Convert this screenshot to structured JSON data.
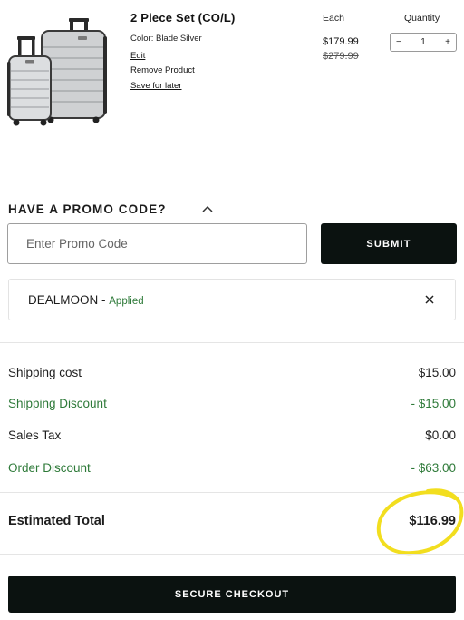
{
  "product": {
    "name": "2 Piece Set (CO/L)",
    "color": "Color: Blade Silver",
    "edit_label": "Edit",
    "remove_label": "Remove Product",
    "save_label": "Save for later",
    "each_header": "Each",
    "price": "$179.99",
    "original_price": "$279.99",
    "quantity_header": "Quantity",
    "quantity": "1",
    "decrement": "−",
    "increment": "+"
  },
  "promo": {
    "heading": "HAVE A PROMO CODE?",
    "placeholder": "Enter Promo Code",
    "submit_label": "SUBMIT",
    "applied_code": "DEALMOON",
    "applied_separator": " - ",
    "applied_status": "Applied"
  },
  "summary": {
    "rows": [
      {
        "label": "Shipping cost",
        "value": "$15.00"
      },
      {
        "label": "Shipping Discount",
        "value": "- $15.00"
      },
      {
        "label": "Sales Tax",
        "value": "$0.00"
      },
      {
        "label": "Order Discount",
        "value": "- $63.00"
      }
    ],
    "total_label": "Estimated Total",
    "total_value": "$116.99"
  },
  "checkout": {
    "label": "SECURE CHECKOUT"
  },
  "colors": {
    "dark_button": "#0b1210",
    "discount_green": "#2e7a39",
    "highlight_yellow": "#f2de1f"
  }
}
